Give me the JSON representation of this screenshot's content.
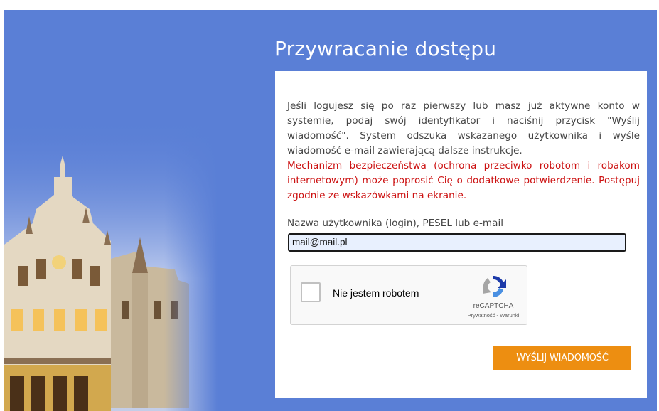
{
  "page": {
    "title": "Przywracanie dostępu"
  },
  "intro_text": "Jeśli logujesz się po raz pierwszy lub masz już aktywne konto w systemie, podaj swój identyfikator i naciśnij przycisk \"Wyślij wiadomość\". System odszuka wskazanego użytkownika i wyśle wiadomość e-mail zawierającą dalsze instrukcje.",
  "warning_text": "Mechanizm bezpieczeństwa (ochrona przeciwko robotom i robakom internetowym) może poprosić Cię o dodatkowe potwierdzenie. Postępuj zgodnie ze wskazówkami na ekranie.",
  "form": {
    "login_label": "Nazwa użytkownika (login), PESEL lub e-mail",
    "login_value": "mail@mail.pl"
  },
  "recaptcha": {
    "checkbox_label": "Nie jestem robotem",
    "brand": "reCAPTCHA",
    "privacy_link": "Prywatność",
    "separator": " - ",
    "terms_link": "Warunki"
  },
  "actions": {
    "send_label": "WYŚLIJ WIADOMOŚĆ"
  },
  "colors": {
    "background": "#5a7fd6",
    "button": "#ed8e11",
    "warning": "#cc1111"
  }
}
